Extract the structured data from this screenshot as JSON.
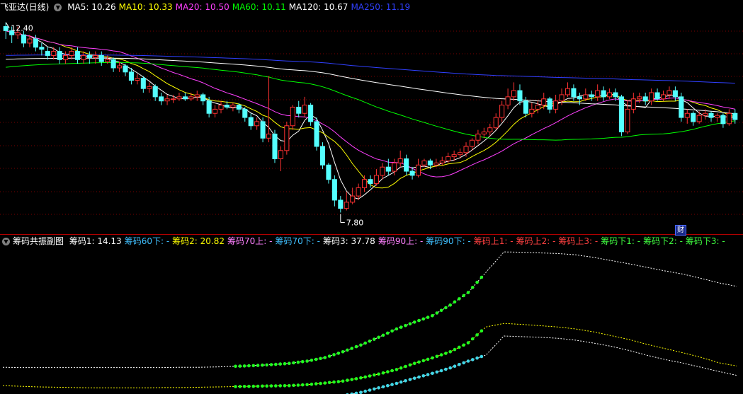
{
  "main_header": {
    "title": "飞亚达(日线)",
    "indicators": [
      {
        "label": "MA5: 10.26",
        "color": "#ffffff"
      },
      {
        "label": "MA10: 10.33",
        "color": "#ffff00"
      },
      {
        "label": "MA20: 10.50",
        "color": "#ff40ff"
      },
      {
        "label": "MA60: 10.11",
        "color": "#00ff00"
      },
      {
        "label": "MA120: 10.67",
        "color": "#ffffff"
      },
      {
        "label": "MA250: 11.19",
        "color": "#3040ff"
      }
    ]
  },
  "sub_header": {
    "title": "筹码共振副图",
    "items": [
      {
        "label": "筹码1: 14.13",
        "color": "#ffffff"
      },
      {
        "label": "筹码60下: -",
        "color": "#40c0ff"
      },
      {
        "label": "筹码2: 20.82",
        "color": "#ffff00"
      },
      {
        "label": "筹码70上: -",
        "color": "#ff80ff"
      },
      {
        "label": "筹码70下: -",
        "color": "#40c0ff"
      },
      {
        "label": "筹码3: 37.78",
        "color": "#ffffff"
      },
      {
        "label": "筹码90上: -",
        "color": "#ff80ff"
      },
      {
        "label": "筹码90下: -",
        "color": "#40c0ff"
      },
      {
        "label": "筹码上1: -",
        "color": "#ff4040"
      },
      {
        "label": "筹码上2: -",
        "color": "#ff4040"
      },
      {
        "label": "筹码上3: -",
        "color": "#ff4040"
      },
      {
        "label": "筹码下1: -",
        "color": "#40ff40"
      },
      {
        "label": "筹码下2: -",
        "color": "#40ff40"
      },
      {
        "label": "筹码下3: -",
        "color": "#40ff40"
      }
    ]
  },
  "cai_badge": "财",
  "chart_data": [
    {
      "type": "candlestick",
      "price_range": [
        7.5,
        12.6
      ],
      "high_label": "12.40",
      "low_label": "7.80",
      "colors": {
        "up": "#ff3232",
        "down": "#54ffff",
        "ma5": "#ffffff",
        "ma10": "#ffff00",
        "ma20": "#ff40ff",
        "ma60": "#00ff00",
        "ma120": "#ffffff",
        "ma250": "#3040ff"
      },
      "candles": [
        [
          12.3,
          12.2,
          12.4,
          12.0
        ],
        [
          12.2,
          12.1,
          12.3,
          11.9
        ],
        [
          12.1,
          12.15,
          12.3,
          12.0
        ],
        [
          12.1,
          11.9,
          12.2,
          11.8
        ],
        [
          11.9,
          12.0,
          12.1,
          11.8
        ],
        [
          12.0,
          11.8,
          12.1,
          11.7
        ],
        [
          11.8,
          11.75,
          11.9,
          11.6
        ],
        [
          11.7,
          11.6,
          11.8,
          11.5
        ],
        [
          11.6,
          11.7,
          11.8,
          11.5
        ],
        [
          11.7,
          11.5,
          11.8,
          11.4
        ],
        [
          11.5,
          11.6,
          11.7,
          11.4
        ],
        [
          11.6,
          11.7,
          11.8,
          11.5
        ],
        [
          11.7,
          11.5,
          11.8,
          11.4
        ],
        [
          11.5,
          11.6,
          11.7,
          11.4
        ],
        [
          11.6,
          11.55,
          11.7,
          11.4
        ],
        [
          11.55,
          11.6,
          11.7,
          11.4
        ],
        [
          11.6,
          11.45,
          11.7,
          11.35
        ],
        [
          11.45,
          11.5,
          11.6,
          11.4
        ],
        [
          11.5,
          11.3,
          11.55,
          11.2
        ],
        [
          11.3,
          11.35,
          11.45,
          11.2
        ],
        [
          11.35,
          11.2,
          11.4,
          11.1
        ],
        [
          11.2,
          11.0,
          11.3,
          10.9
        ],
        [
          11.0,
          11.05,
          11.15,
          10.9
        ],
        [
          11.05,
          10.8,
          11.1,
          10.7
        ],
        [
          10.8,
          10.85,
          10.95,
          10.7
        ],
        [
          10.85,
          10.6,
          10.9,
          10.5
        ],
        [
          10.6,
          10.5,
          10.7,
          10.4
        ],
        [
          10.5,
          10.55,
          10.65,
          10.4
        ],
        [
          10.55,
          10.55,
          10.65,
          10.45
        ],
        [
          10.55,
          10.6,
          10.7,
          10.5
        ],
        [
          10.6,
          10.55,
          10.7,
          10.5
        ],
        [
          10.55,
          10.6,
          10.7,
          10.5
        ],
        [
          10.6,
          10.65,
          10.75,
          10.5
        ],
        [
          10.65,
          10.5,
          10.7,
          10.4
        ],
        [
          10.5,
          10.2,
          10.6,
          10.1
        ],
        [
          10.2,
          10.3,
          10.4,
          10.1
        ],
        [
          10.3,
          10.4,
          10.5,
          10.2
        ],
        [
          10.4,
          10.35,
          10.5,
          10.3
        ],
        [
          10.35,
          10.4,
          10.45,
          10.25
        ],
        [
          10.4,
          10.3,
          10.45,
          10.2
        ],
        [
          10.3,
          10.1,
          10.35,
          10.0
        ],
        [
          10.1,
          9.9,
          10.2,
          9.8
        ],
        [
          9.9,
          10.0,
          10.1,
          9.8
        ],
        [
          10.0,
          9.6,
          10.1,
          9.5
        ],
        [
          9.6,
          9.7,
          11.1,
          9.5
        ],
        [
          9.7,
          9.1,
          9.8,
          9.0
        ],
        [
          9.1,
          9.3,
          9.4,
          8.8
        ],
        [
          9.3,
          9.9,
          10.0,
          9.2
        ],
        [
          9.9,
          10.35,
          10.4,
          9.8
        ],
        [
          10.35,
          10.2,
          10.5,
          10.1
        ],
        [
          10.2,
          10.4,
          10.6,
          10.1
        ],
        [
          10.4,
          10.0,
          10.45,
          9.9
        ],
        [
          10.0,
          9.4,
          10.1,
          9.3
        ],
        [
          9.4,
          8.95,
          9.5,
          8.85
        ],
        [
          8.95,
          8.6,
          9.0,
          8.5
        ],
        [
          8.6,
          8.1,
          8.7,
          7.95
        ],
        [
          8.1,
          7.9,
          8.2,
          7.8
        ],
        [
          7.9,
          8.05,
          8.3,
          7.85
        ],
        [
          8.05,
          8.2,
          8.4,
          8.0
        ],
        [
          8.2,
          8.4,
          8.5,
          8.1
        ],
        [
          8.4,
          8.6,
          8.7,
          8.3
        ],
        [
          8.6,
          8.5,
          8.7,
          8.4
        ],
        [
          8.5,
          8.7,
          8.85,
          8.45
        ],
        [
          8.7,
          8.9,
          9.0,
          8.6
        ],
        [
          8.9,
          8.8,
          9.1,
          8.7
        ],
        [
          8.8,
          9.0,
          9.1,
          8.7
        ],
        [
          9.0,
          9.1,
          9.3,
          8.9
        ],
        [
          9.1,
          8.8,
          9.2,
          8.7
        ],
        [
          8.8,
          8.7,
          8.9,
          8.6
        ],
        [
          8.7,
          8.95,
          9.1,
          8.65
        ],
        [
          8.95,
          9.05,
          9.1,
          8.9
        ],
        [
          9.05,
          8.95,
          9.1,
          8.85
        ],
        [
          8.95,
          9.0,
          9.1,
          8.9
        ],
        [
          9.0,
          9.05,
          9.15,
          8.95
        ],
        [
          9.05,
          9.15,
          9.25,
          9.0
        ],
        [
          9.15,
          9.2,
          9.3,
          9.05
        ],
        [
          9.2,
          9.25,
          9.35,
          9.1
        ],
        [
          9.25,
          9.4,
          9.5,
          9.15
        ],
        [
          9.4,
          9.55,
          9.6,
          9.3
        ],
        [
          9.55,
          9.7,
          9.8,
          9.45
        ],
        [
          9.7,
          9.75,
          9.85,
          9.6
        ],
        [
          9.75,
          9.85,
          9.95,
          9.65
        ],
        [
          9.85,
          10.1,
          10.2,
          9.8
        ],
        [
          10.1,
          10.4,
          10.5,
          10.0
        ],
        [
          10.4,
          10.6,
          10.8,
          10.3
        ],
        [
          10.6,
          10.75,
          10.95,
          10.5
        ],
        [
          10.75,
          10.5,
          10.9,
          10.4
        ],
        [
          10.5,
          10.2,
          10.6,
          10.1
        ],
        [
          10.2,
          10.3,
          10.45,
          10.1
        ],
        [
          10.3,
          10.4,
          10.5,
          10.2
        ],
        [
          10.4,
          10.55,
          10.7,
          10.3
        ],
        [
          10.55,
          10.3,
          10.6,
          10.2
        ],
        [
          10.3,
          10.5,
          10.65,
          10.2
        ],
        [
          10.5,
          10.65,
          10.8,
          10.4
        ],
        [
          10.65,
          10.8,
          10.95,
          10.6
        ],
        [
          10.8,
          10.6,
          10.9,
          10.5
        ],
        [
          10.6,
          10.55,
          10.7,
          10.4
        ],
        [
          10.55,
          10.65,
          10.8,
          10.5
        ],
        [
          10.65,
          10.6,
          10.75,
          10.5
        ],
        [
          10.6,
          10.75,
          10.9,
          10.5
        ],
        [
          10.75,
          10.6,
          10.85,
          10.5
        ],
        [
          10.6,
          10.7,
          10.8,
          10.55
        ],
        [
          10.7,
          10.6,
          10.8,
          10.5
        ],
        [
          10.6,
          9.75,
          10.65,
          9.65
        ],
        [
          9.75,
          10.3,
          10.5,
          9.7
        ],
        [
          10.3,
          10.55,
          10.7,
          10.2
        ],
        [
          10.55,
          10.6,
          10.7,
          10.45
        ],
        [
          10.6,
          10.5,
          10.7,
          10.4
        ],
        [
          10.5,
          10.7,
          10.8,
          10.4
        ],
        [
          10.7,
          10.55,
          10.8,
          10.5
        ],
        [
          10.55,
          10.65,
          10.75,
          10.5
        ],
        [
          10.65,
          10.75,
          10.85,
          10.55
        ],
        [
          10.75,
          10.6,
          10.85,
          10.5
        ],
        [
          10.6,
          10.1,
          10.7,
          10.0
        ],
        [
          10.1,
          10.2,
          10.3,
          9.95
        ],
        [
          10.2,
          10.0,
          10.25,
          9.9
        ],
        [
          10.0,
          10.15,
          10.25,
          9.95
        ],
        [
          10.15,
          10.2,
          10.3,
          10.05
        ],
        [
          10.2,
          10.1,
          10.25,
          10.0
        ],
        [
          10.1,
          10.15,
          10.2,
          10.0
        ],
        [
          10.15,
          9.95,
          10.2,
          9.85
        ],
        [
          9.95,
          10.2,
          10.3,
          9.9
        ],
        [
          10.2,
          10.05,
          10.3,
          9.95
        ]
      ]
    },
    {
      "type": "line",
      "title": "筹码共振副图",
      "y_range": [
        0,
        45
      ],
      "series": [
        {
          "name": "筹码3",
          "color": "#ffffff",
          "values": [
            8.3,
            8.2,
            8.2,
            8.2,
            8.2,
            8.2,
            8.2,
            8.2,
            8.2,
            8.2,
            8.3,
            8.3,
            8.4,
            8.6,
            8.8,
            9.1,
            9.5,
            10.2,
            11.3,
            13.1,
            15.2,
            17.6,
            20.2,
            22.3,
            24.3,
            27.6,
            31.5,
            37.8,
            44.1,
            44.0,
            43.8,
            43.6,
            43.2,
            42.4,
            41.4,
            40.4,
            39.3,
            38.2,
            37.2,
            35.9,
            34.5,
            33.4
          ]
        },
        {
          "name": "筹码2",
          "color": "#ffff00",
          "values": [
            2.6,
            2.4,
            2.2,
            2.1,
            2.0,
            1.9,
            1.9,
            1.9,
            1.9,
            2.0,
            2.0,
            2.1,
            2.2,
            2.3,
            2.4,
            2.5,
            2.6,
            2.9,
            3.4,
            4.0,
            5.0,
            6.2,
            7.6,
            9.5,
            11.2,
            13.1,
            15.9,
            20.8,
            21.9,
            21.6,
            21.2,
            20.8,
            20.2,
            19.3,
            18.1,
            16.9,
            15.4,
            14.1,
            12.8,
            11.4,
            9.7,
            8.7
          ]
        },
        {
          "name": "筹码1",
          "color": "#ffffff",
          "values": [
            -3.2,
            -3.6,
            -3.8,
            -3.9,
            -4.0,
            -4.0,
            -4.0,
            -4.0,
            -4.0,
            -3.9,
            -3.8,
            -3.5,
            -3.2,
            -2.9,
            -2.6,
            -2.3,
            -2.0,
            -1.6,
            -1.1,
            -0.5,
            0.5,
            1.9,
            3.3,
            4.9,
            6.4,
            8.1,
            10.2,
            12.1,
            18.0,
            17.8,
            17.6,
            17.3,
            16.7,
            15.8,
            14.8,
            13.5,
            12.0,
            10.7,
            9.6,
            8.3,
            7.0,
            5.8
          ]
        }
      ]
    }
  ]
}
